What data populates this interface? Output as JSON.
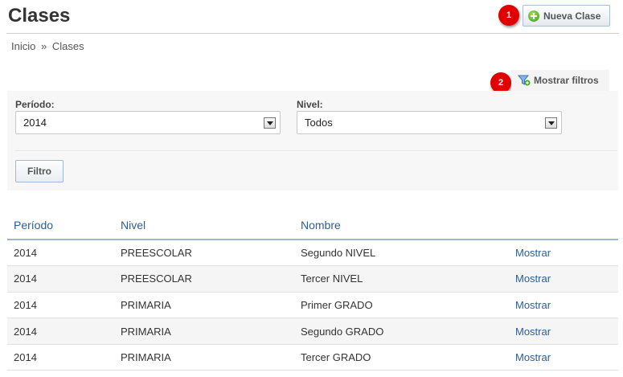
{
  "header": {
    "title": "Clases",
    "new_button_label": "Nueva Clase"
  },
  "markers": [
    "1",
    "2"
  ],
  "breadcrumb": {
    "items": [
      "Inicio",
      "Clases"
    ],
    "separator": "»"
  },
  "filters_toggle": {
    "label": "Mostrar filtros"
  },
  "filters": {
    "periodo": {
      "label": "Período:",
      "value": "2014"
    },
    "nivel": {
      "label": "Nivel:",
      "value": "Todos"
    },
    "submit_label": "Filtro"
  },
  "table": {
    "headers": [
      "Período",
      "Nivel",
      "Nombre"
    ],
    "rows": [
      {
        "periodo": "2014",
        "nivel": "PREESCOLAR",
        "nombre": "Segundo NIVEL",
        "action": "Mostrar"
      },
      {
        "periodo": "2014",
        "nivel": "PREESCOLAR",
        "nombre": "Tercer NIVEL",
        "action": "Mostrar"
      },
      {
        "periodo": "2014",
        "nivel": "PRIMARIA",
        "nombre": "Primer GRADO",
        "action": "Mostrar"
      },
      {
        "periodo": "2014",
        "nivel": "PRIMARIA",
        "nombre": "Segundo GRADO",
        "action": "Mostrar"
      },
      {
        "periodo": "2014",
        "nivel": "PRIMARIA",
        "nombre": "Tercer GRADO",
        "action": "Mostrar"
      }
    ]
  },
  "colors": {
    "link": "#2d5e95",
    "marker": "#e00000",
    "table_header_rule": "#9bb6d1",
    "stripe": "#f5f5f5"
  }
}
